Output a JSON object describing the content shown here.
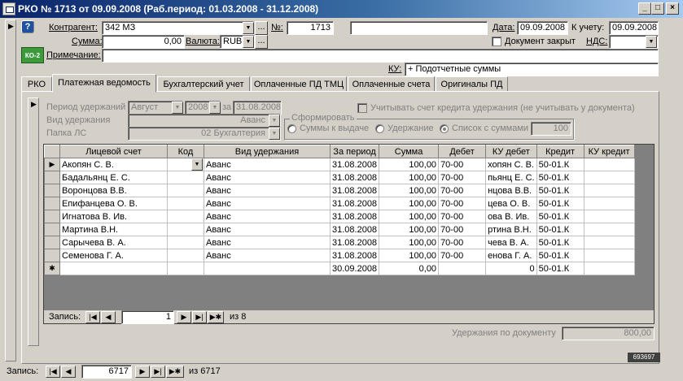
{
  "window": {
    "title": "РКО № 1713 от 09.09.2008 (Раб.период: 01.03.2008 - 31.12.2008)"
  },
  "form": {
    "kontragent_label": "Контрагент:",
    "kontragent_value": "342 МЗ",
    "nomer_label": "№:",
    "nomer_value": "1713",
    "date_label": "Дата:",
    "date_value": "09.09.2008",
    "k_uchetu_label": "К учету:",
    "k_uchetu_value": "09.09.2008",
    "summa_label": "Сумма:",
    "summa_value": "0,00",
    "valuta_label": "Валюта:",
    "valuta_value": "RUB",
    "doc_closed_label": "Документ закрыт",
    "nds_label": "НДС:",
    "nds_value": "",
    "primechanie_label": "Примечание:",
    "primechanie_value": "",
    "ku_label": "КУ:",
    "ku_value": "+ Подотчетные суммы",
    "ko_badge": "КО-2",
    "ellipsis": "...",
    "help_glyph": "?"
  },
  "tabs": [
    "РКО",
    "Платежная ведомость",
    "Бухгалтерский учет",
    "Оплаченные ПД ТМЦ",
    "Оплаченные счета",
    "Оригиналы ПД"
  ],
  "subform": {
    "period_label": "Период удержаний",
    "period_month": "Август",
    "period_year": "2008",
    "za_label": "за",
    "za_value": "31.08.2008",
    "vid_label": "Вид удержания",
    "vid_value": "Аванс",
    "papka_label": "Папка ЛС",
    "papka_value": "02 Бухгалтерия",
    "credit_check_label": "Учитывать счет кредита удержания (не учитывать у документа)",
    "group_label": "Сформировать",
    "radio1": "Суммы к выдаче",
    "radio2": "Удержание",
    "radio3": "Список с суммами",
    "list_value": "100",
    "total_label": "Удержания по документу",
    "total_value": "800,00",
    "record_label": "Запись:",
    "record_current": "1",
    "record_of": "из  8"
  },
  "grid": {
    "columns": [
      "Лицевой счет",
      "Код",
      "Вид удержания",
      "За период",
      "Сумма",
      "Дебет",
      "КУ дебет",
      "Кредит",
      "КУ кредит"
    ],
    "rows": [
      [
        "Акопян С. В.",
        "",
        "Аванс",
        "31.08.2008",
        "100,00",
        "70-00",
        "хопян С. В.",
        "50-01.К",
        ""
      ],
      [
        "Бадальянц Е. С.",
        "",
        "Аванс",
        "31.08.2008",
        "100,00",
        "70-00",
        "пьянц Е. С.",
        "50-01.К",
        ""
      ],
      [
        "Воронцова В.В.",
        "",
        "Аванс",
        "31.08.2008",
        "100,00",
        "70-00",
        "нцова В.В.",
        "50-01.К",
        ""
      ],
      [
        "Епифанцева О. В.",
        "",
        "Аванс",
        "31.08.2008",
        "100,00",
        "70-00",
        "цева О. В.",
        "50-01.К",
        ""
      ],
      [
        "Игнатова В. Ив.",
        "",
        "Аванс",
        "31.08.2008",
        "100,00",
        "70-00",
        "ова В. Ив.",
        "50-01.К",
        ""
      ],
      [
        "Мартина В.Н.",
        "",
        "Аванс",
        "31.08.2008",
        "100,00",
        "70-00",
        "ртина В.Н.",
        "50-01.К",
        ""
      ],
      [
        "Сарычева  В. А.",
        "",
        "Аванс",
        "31.08.2008",
        "100,00",
        "70-00",
        "чева  В. А.",
        "50-01.К",
        ""
      ],
      [
        "Семенова Г. А.",
        "",
        "Аванс",
        "31.08.2008",
        "100,00",
        "70-00",
        "енова Г. А.",
        "50-01.К",
        ""
      ]
    ],
    "new_row": [
      "",
      "",
      "",
      "30.09.2008",
      "0,00",
      "",
      "0",
      "50-01.К",
      ""
    ],
    "current_marker": "▶",
    "new_marker": "✱"
  },
  "footer": {
    "record_label": "Запись:",
    "record_current": "6717",
    "record_of": "из  6717",
    "corner_code": "693697"
  }
}
